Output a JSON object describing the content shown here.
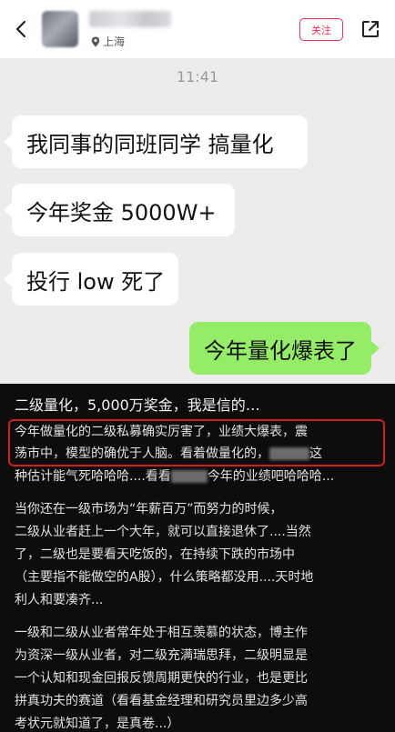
{
  "header": {
    "location": "上海",
    "follow_label": "关注"
  },
  "chat": {
    "time": "11:41",
    "messages": [
      {
        "text": "我同事的同班同学 搞量化"
      },
      {
        "text": "今年奖金 5000W+"
      },
      {
        "text": "投行 low 死了"
      },
      {
        "text": "今年量化爆表了"
      }
    ]
  },
  "article": {
    "headline": "二级量化，5,000万奖金，我是信的…",
    "p1": {
      "l1": "今年做量化的二级私募确实厉害了，业绩大爆表，震",
      "l2a": "荡市中，模型的确优于人脑。看着做量化的，",
      "l2b": "这",
      "l3a": "种估计能气死哈哈哈....看看",
      "l3b": "今年的业绩吧哈哈哈..."
    },
    "p2": [
      "当你还在一级市场为“年薪百万”而努力的时候，",
      "二级从业者赶上一个大年，就可以直接退休了....当然",
      "了，二级也是要看天吃饭的，在持续下跌的市场中",
      "（主要指不能做空的A股），什么策略都没用....天时地",
      "利人和要凑齐..."
    ],
    "p3": [
      "一级和二级从业者常年处于相互羡慕的状态，博主作",
      "为资深一级从业者，对二级充满瑞思拜，二级明显是",
      "一个认知和现金回报反馈周期更快的行业，也是更比",
      "拼真功夫的赛道（看看基金经理和研究员里边多少高",
      "考状元就知道了，是真卷...）"
    ]
  }
}
